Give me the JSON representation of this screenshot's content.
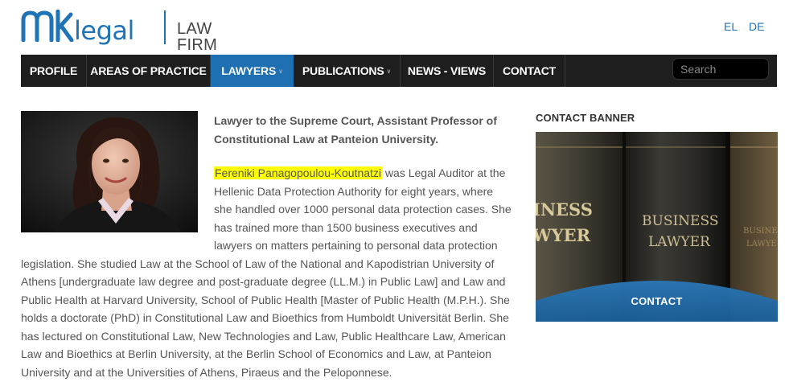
{
  "header": {
    "logo_mark": "MK",
    "logo_text": "legal",
    "logo_subtitle": "LAW FIRM",
    "languages": [
      "EL",
      "DE"
    ]
  },
  "nav": {
    "items": [
      {
        "label": "PROFILE",
        "active": false,
        "has_dropdown": false
      },
      {
        "label": "AREAS OF PRACTICE",
        "active": false,
        "has_dropdown": false
      },
      {
        "label": "LAWYERS",
        "active": true,
        "has_dropdown": true
      },
      {
        "label": "PUBLICATIONS",
        "active": false,
        "has_dropdown": true
      },
      {
        "label": "NEWS - VIEWS",
        "active": false,
        "has_dropdown": false
      },
      {
        "label": "CONTACT",
        "active": false,
        "has_dropdown": false
      }
    ],
    "search_placeholder": "Search"
  },
  "profile": {
    "subtitle": "Lawyer to the Supreme Court, Assistant Professor of Constitutional Law at Panteion University.",
    "name": "Fereniki Panagopoulou-Koutnatzi",
    "bio": " was Legal Auditor at the Hellenic Data Protection Authority for eight years, where she handled over 1000 personal data protection cases. She has trained more than 1500 business executives and lawyers on matters pertaining to personal data protection legislation. She studied Law at the School of Law of the National and Kapodistrian University of Athens [undergraduate law degree and post-graduate degree (LL.M.) in Public Law] and Law and Public Health at Harvard University, School of Public Health [Master of Public Health (M.P.H.). She holds a doctorate (PhD) in Constitutional Law and Bioethics from Humboldt Universität Berlin. She has lectured on Constitutional Law, New Technologies and Law, Public Healthcare Law, American Law and Bioethics at Berlin University, at the Berlin School of Economics and Law, at Panteion University and at the Universities of Athens, Piraeus and the Peloponnese."
  },
  "sidebar": {
    "banner_title": "CONTACT BANNER",
    "banner_book_left": [
      "INESS",
      "WYER"
    ],
    "banner_book_center": [
      "BUSINESS",
      "LAWYER"
    ],
    "banner_contact": "CONTACT"
  },
  "colors": {
    "brand_blue": "#1f74b8",
    "nav_bg": "#1e1e1e",
    "nav_active": "#1f6fb3",
    "highlight": "#ffff00"
  },
  "icons": [
    "chevron-down-icon",
    "mk-logo-icon"
  ]
}
